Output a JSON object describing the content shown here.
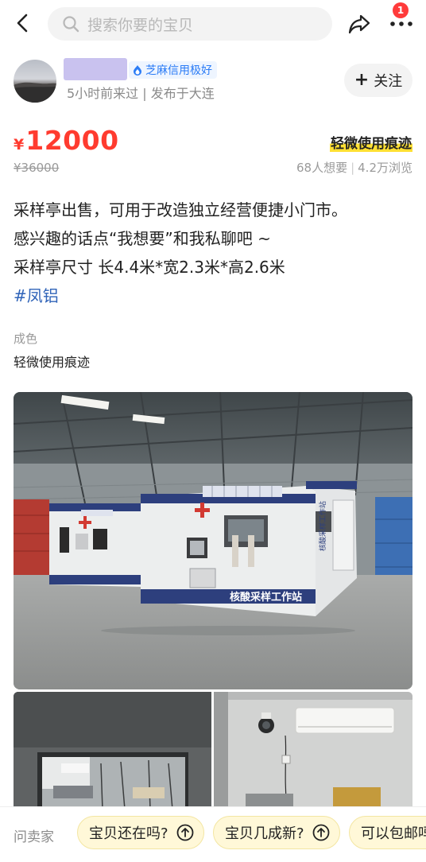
{
  "search": {
    "placeholder": "搜索你要的宝贝"
  },
  "header": {
    "notification_count": "1"
  },
  "seller": {
    "credit_badge": "芝麻信用极好",
    "meta": "5小时前来过 | 发布于大连",
    "follow_label": "关注"
  },
  "price": {
    "currency": "¥",
    "current": "12000",
    "original": "¥36000",
    "condition_tag": "轻微使用痕迹",
    "wants": "68人想要",
    "views": "4.2万浏览"
  },
  "description": {
    "line1": "采样亭出售，可用于改造独立经营便捷小门市。",
    "line2": "感兴趣的话点“我想要”和我私聊吧 ~",
    "line3": "采样亭尺寸 长4.4米*宽2.3米*高2.6米",
    "tag": "#凤铝"
  },
  "condition": {
    "label": "成色",
    "value": "轻微使用痕迹"
  },
  "photo_text": {
    "booth_sign": "核酸采样工作站",
    "booth_side": "核酸采样工作站"
  },
  "bottom": {
    "ask_label": "问卖家",
    "chips": [
      "宝贝还在吗?",
      "宝贝几成新?",
      "可以包邮吗"
    ]
  },
  "colors": {
    "price": "#ff3b2f",
    "accent_blue": "#2f63b8",
    "badge": "#ff3b3b",
    "highlight": "#ffe033"
  }
}
